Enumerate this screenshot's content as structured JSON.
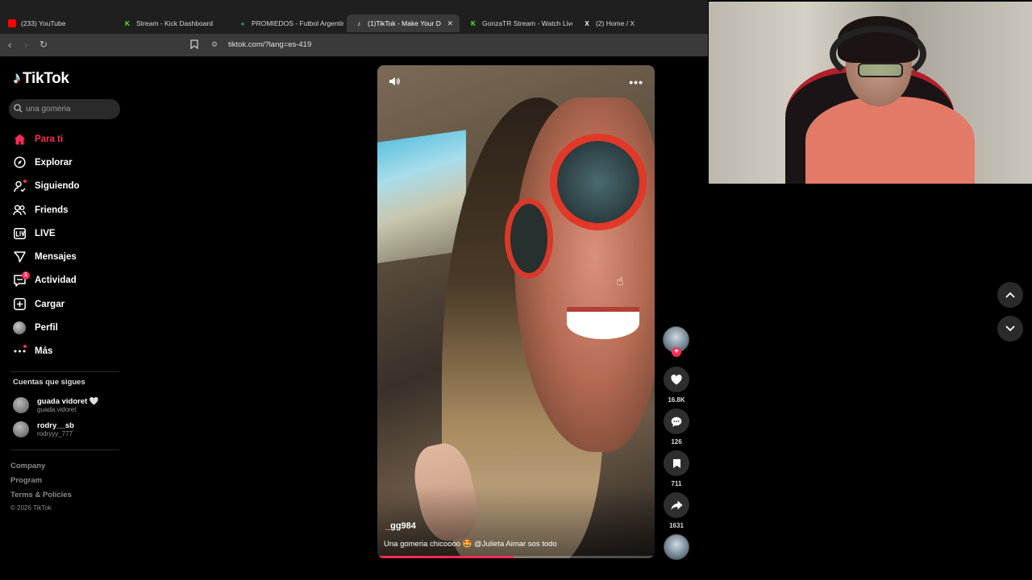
{
  "browser": {
    "tabs": [
      {
        "title": "(233) YouTube",
        "icon": "youtube-icon",
        "color": "#ff0000",
        "active": false
      },
      {
        "title": "Stream - Kick Dashboard",
        "icon": "kick-icon",
        "color": "#53fc18",
        "active": false
      },
      {
        "title": "PROMIEDOS - Futbol Argentin",
        "icon": "promiedos-icon",
        "color": "#2e9e4a",
        "active": false
      },
      {
        "title": "(1)TikTok - Make Your D",
        "icon": "tiktok-icon",
        "color": "#ffffff",
        "active": true
      },
      {
        "title": "GonzaTR Stream - Watch Live ·",
        "icon": "kick-icon",
        "color": "#53fc18",
        "active": false
      },
      {
        "title": "(2) Home / X",
        "icon": "x-icon",
        "color": "#ffffff",
        "active": false
      }
    ],
    "url": "tiktok.com/?lang=es-419"
  },
  "sidebar": {
    "logo_text": "TikTok",
    "search_placeholder": "una gomeria",
    "nav": [
      {
        "label": "Para ti",
        "icon": "home-icon",
        "active": true
      },
      {
        "label": "Explorar",
        "icon": "compass-icon"
      },
      {
        "label": "Siguiendo",
        "icon": "following-icon",
        "dot": true
      },
      {
        "label": "Friends",
        "icon": "friends-icon"
      },
      {
        "label": "LIVE",
        "icon": "live-icon"
      },
      {
        "label": "Mensajes",
        "icon": "messages-icon"
      },
      {
        "label": "Actividad",
        "icon": "activity-icon",
        "badge": "1"
      },
      {
        "label": "Cargar",
        "icon": "upload-icon"
      },
      {
        "label": "Perfil",
        "icon": "profile-avatar"
      },
      {
        "label": "Más",
        "icon": "more-icon",
        "dot": true
      }
    ],
    "following_title": "Cuentas que sigues",
    "following": [
      {
        "name": "guada vidoret 🤍",
        "user": "guada.vidoret"
      },
      {
        "name": "rodry__sb",
        "user": "rodryyy_777"
      }
    ],
    "footer": [
      "Company",
      "Program",
      "Terms & Policies"
    ],
    "copyright": "© 2026 TikTok"
  },
  "video": {
    "author": "_gg984",
    "caption": "Una gomeria chicoooo 🤩 @Julieta Aimar sos todo",
    "progress": 0.49
  },
  "actions": {
    "likes": "16.8K",
    "comments": "126",
    "saves": "711",
    "shares": "1631"
  },
  "colors": {
    "accent": "#fe2c55",
    "background": "#000000"
  }
}
